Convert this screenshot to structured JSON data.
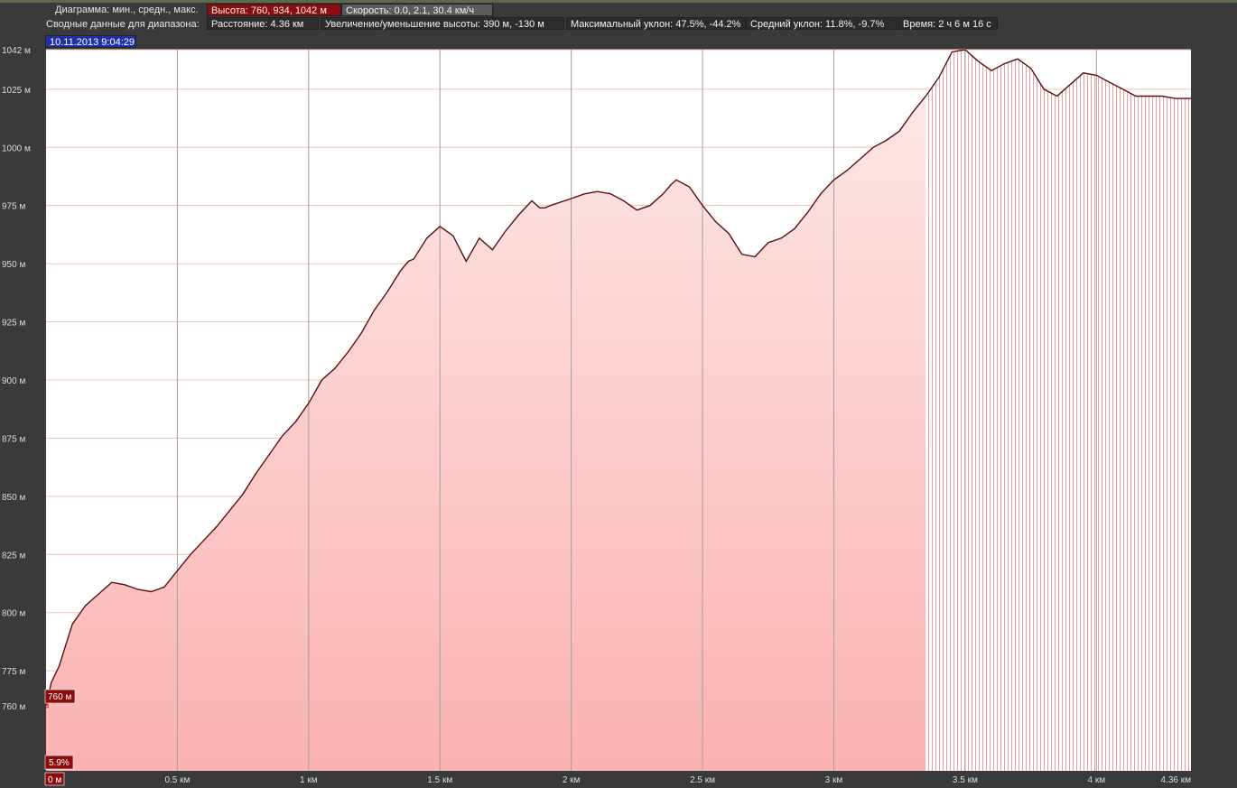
{
  "header": {
    "diagram_label": "Диаграмма: мин., средн., макс.",
    "altitude_value": "Высота: 760, 934, 1042 м",
    "speed_value": "Скорость: 0.0, 2.1, 30.4 км/ч",
    "summary_label": "Сводные данные для диапазона:",
    "distance_value": "Расстояние: 4.36 км",
    "elevation_change_value": "Увеличение/уменьшение высоты: 390 м, -130 м",
    "max_slope_value": "Максимальный уклон: 47.5%, -44.2%",
    "avg_slope_value": "Средний уклон: 11.8%, -9.7%",
    "time_value": "Время: 2 ч 6 м 16 с",
    "timestamp": "10.11.2013 9:04:29"
  },
  "markers": {
    "start_altitude": "760 м",
    "slope_badge": "5.9%",
    "start_distance": "0 м"
  },
  "colors": {
    "area_fill": "#fbb6b6",
    "line": "#5a0f0f",
    "highlight": "#8b0d0d",
    "grid_h": "#f0c0b0",
    "grid_v": "#a0a0a0"
  },
  "chart_data": {
    "type": "area",
    "xlabel": "",
    "ylabel": "",
    "xlim": [
      0,
      4.36
    ],
    "ylim": [
      732,
      1042
    ],
    "y_ticks": [
      {
        "value": 1042,
        "label": "1042 м"
      },
      {
        "value": 1025,
        "label": "1025 м"
      },
      {
        "value": 1000,
        "label": "1000 м"
      },
      {
        "value": 975,
        "label": "975 м"
      },
      {
        "value": 950,
        "label": "950 м"
      },
      {
        "value": 925,
        "label": "925 м"
      },
      {
        "value": 900,
        "label": "900 м"
      },
      {
        "value": 875,
        "label": "875 м"
      },
      {
        "value": 850,
        "label": "850 м"
      },
      {
        "value": 825,
        "label": "825 м"
      },
      {
        "value": 800,
        "label": "800 м"
      },
      {
        "value": 775,
        "label": "775 м"
      },
      {
        "value": 760,
        "label": "760 м"
      }
    ],
    "x_ticks": [
      {
        "value": 0.5,
        "label": "0.5 км"
      },
      {
        "value": 1.0,
        "label": "1 км"
      },
      {
        "value": 1.5,
        "label": "1.5 км"
      },
      {
        "value": 2.0,
        "label": "2 км"
      },
      {
        "value": 2.5,
        "label": "2.5 км"
      },
      {
        "value": 3.0,
        "label": "3 км"
      },
      {
        "value": 3.5,
        "label": "3.5 км"
      },
      {
        "value": 4.0,
        "label": "4 км"
      },
      {
        "value": 4.36,
        "label": "4.36 км"
      }
    ],
    "hatched_from_km": 3.35,
    "series": [
      {
        "x": [
          0,
          0.02,
          0.05,
          0.1,
          0.15,
          0.2,
          0.25,
          0.3,
          0.35,
          0.4,
          0.45,
          0.5,
          0.55,
          0.6,
          0.65,
          0.7,
          0.75,
          0.8,
          0.85,
          0.9,
          0.95,
          1.0,
          1.05,
          1.1,
          1.15,
          1.2,
          1.25,
          1.3,
          1.35,
          1.38,
          1.4,
          1.45,
          1.5,
          1.55,
          1.6,
          1.65,
          1.7,
          1.75,
          1.8,
          1.85,
          1.88,
          1.9,
          1.92,
          2.0,
          2.05,
          2.1,
          2.15,
          2.2,
          2.25,
          2.3,
          2.35,
          2.38,
          2.4,
          2.45,
          2.5,
          2.55,
          2.6,
          2.65,
          2.7,
          2.75,
          2.8,
          2.85,
          2.9,
          2.95,
          3.0,
          3.05,
          3.1,
          3.15,
          3.2,
          3.25,
          3.3,
          3.35,
          3.4,
          3.45,
          3.5,
          3.55,
          3.6,
          3.65,
          3.7,
          3.75,
          3.8,
          3.85,
          3.9,
          3.95,
          4.0,
          4.05,
          4.1,
          4.15,
          4.2,
          4.25,
          4.3,
          4.36
        ],
        "y": [
          760,
          770,
          777,
          795,
          803,
          808,
          813,
          812,
          810,
          809,
          811,
          818,
          825,
          831,
          837,
          844,
          851,
          860,
          868,
          876,
          882,
          890,
          900,
          905,
          912,
          920,
          930,
          938,
          947,
          951,
          952,
          961,
          966,
          962,
          951,
          961,
          956,
          964,
          971,
          977,
          974,
          974,
          975,
          978,
          980,
          981,
          980,
          977,
          973,
          975,
          980,
          984,
          986,
          983,
          975,
          968,
          963,
          954,
          953,
          959,
          961,
          965,
          972,
          980,
          986,
          990,
          995,
          1000,
          1003,
          1007,
          1015,
          1022,
          1030,
          1041,
          1042,
          1037,
          1033,
          1036,
          1038,
          1034,
          1025,
          1022,
          1027,
          1032,
          1031,
          1028,
          1025,
          1022,
          1022,
          1022,
          1021,
          1021
        ]
      }
    ]
  }
}
